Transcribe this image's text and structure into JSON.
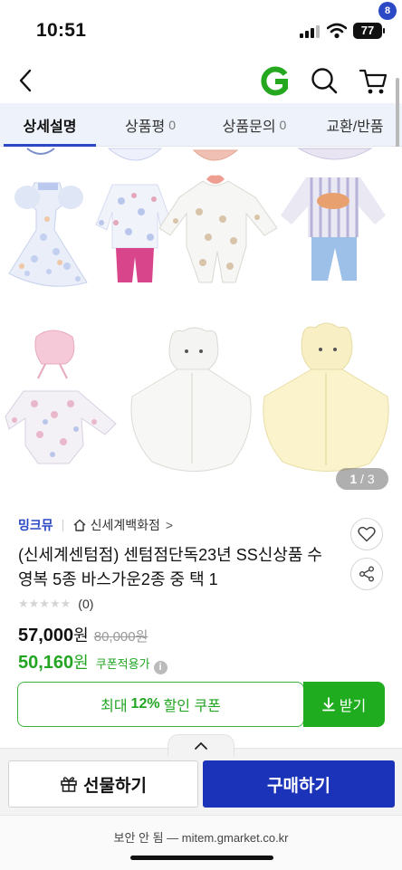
{
  "status_bar": {
    "time": "10:51",
    "battery": "77"
  },
  "nav": {
    "cart_count": "8"
  },
  "tabs": [
    {
      "label": "상세설명",
      "count": ""
    },
    {
      "label": "상품평",
      "count": "0"
    },
    {
      "label": "상품문의",
      "count": "0"
    },
    {
      "label": "교환/반품",
      "count": ""
    }
  ],
  "gallery": {
    "current": "1",
    "separator": " / ",
    "total": "3"
  },
  "product": {
    "seller": "밍크뮤",
    "store": "신세계백화점",
    "store_chevron": ">",
    "title": "(신세계센텀점) 센텀점단독23년 SS신상품 수영복 5종 바스가운2종 중 택 1",
    "stars": "★★★★★",
    "review_count": "(0)",
    "price": "57,000",
    "price_unit": "원",
    "original_price": "80,000원",
    "coupon_price": "50,160",
    "coupon_unit": "원",
    "coupon_label": "쿠폰적용가",
    "info_symbol": "i"
  },
  "coupon": {
    "prefix": "최대",
    "percent": "12%",
    "suffix": "할인 쿠폰",
    "download": "받기"
  },
  "actions": {
    "gift": "선물하기",
    "buy": "구매하기"
  },
  "browser": {
    "url_text": "보안 안 됨 — mitem.gmarket.co.kr"
  },
  "colors": {
    "brand_blue": "#2b49c4",
    "buy_blue": "#1a33b8",
    "coupon_green": "#22a622",
    "g_logo_green": "#25a81f"
  }
}
